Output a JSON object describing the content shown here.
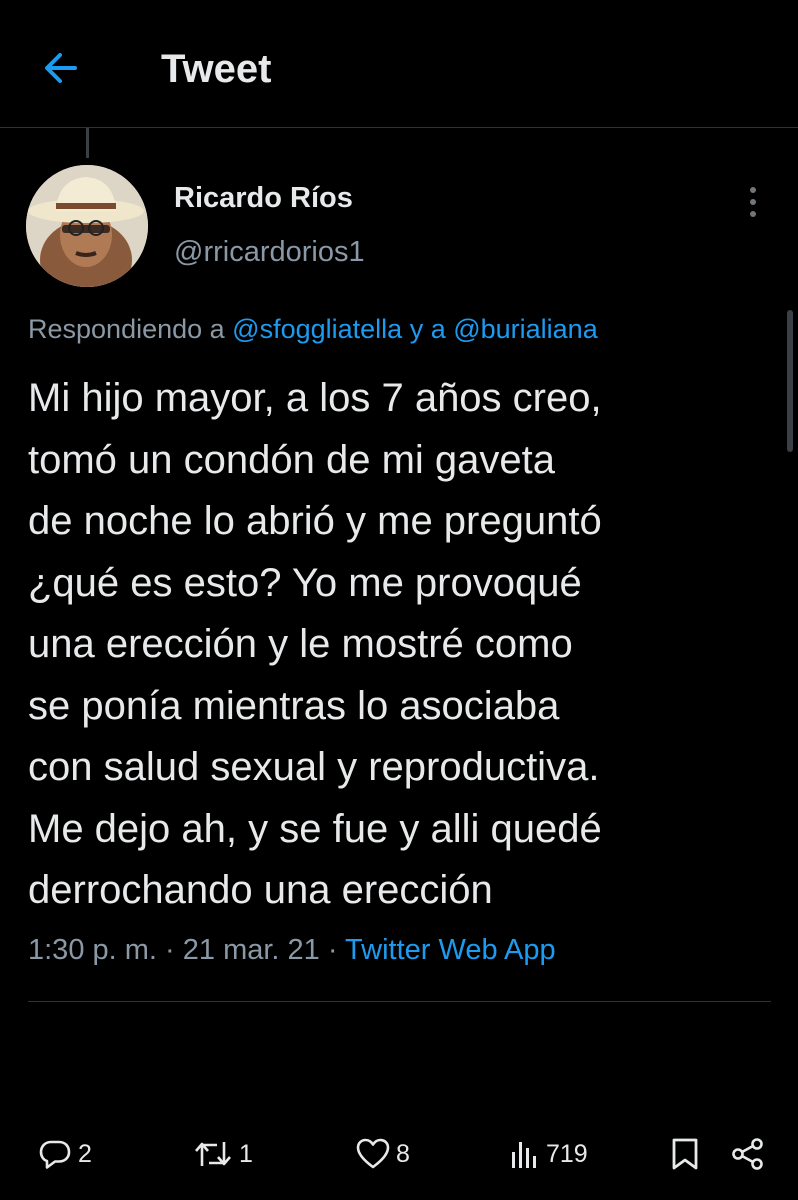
{
  "header": {
    "title": "Tweet"
  },
  "tweet": {
    "author": {
      "display_name": "Ricardo Ríos",
      "handle": "@rricardorios1"
    },
    "reply_prefix": "Respondiendo a ",
    "reply_mention_1": "@sfoggliatella",
    "reply_joiner": " y a ",
    "reply_mention_2": "@burialiana",
    "text": "Mi hijo mayor, a los 7 años creo,\ntomó un condón de mi gaveta\nde noche lo abrió y me preguntó\n¿qué es esto? Yo me provoqué\nuna erección y le mostré como\nse ponía mientras lo asociaba\ncon salud sexual y reproductiva.\nMe dejo ah, y se fue y alli quedé\nderrochando una erección",
    "time": "1:30 p. m.",
    "separator": " · ",
    "date": "21 mar. 21",
    "source": "Twitter Web App"
  },
  "actions": {
    "replies": "2",
    "retweets": "1",
    "likes": "8",
    "views": "719"
  },
  "colors": {
    "background": "#000000",
    "text": "#e7e9ea",
    "secondary_text": "#8b98a5",
    "accent": "#1d9bf0",
    "divider": "#2f3336"
  },
  "icons": {
    "back": "arrow-left-icon",
    "more": "more-vertical-icon",
    "reply": "reply-icon",
    "retweet": "retweet-icon",
    "like": "heart-icon",
    "views": "views-chart-icon",
    "bookmark": "bookmark-icon",
    "share": "share-icon"
  }
}
